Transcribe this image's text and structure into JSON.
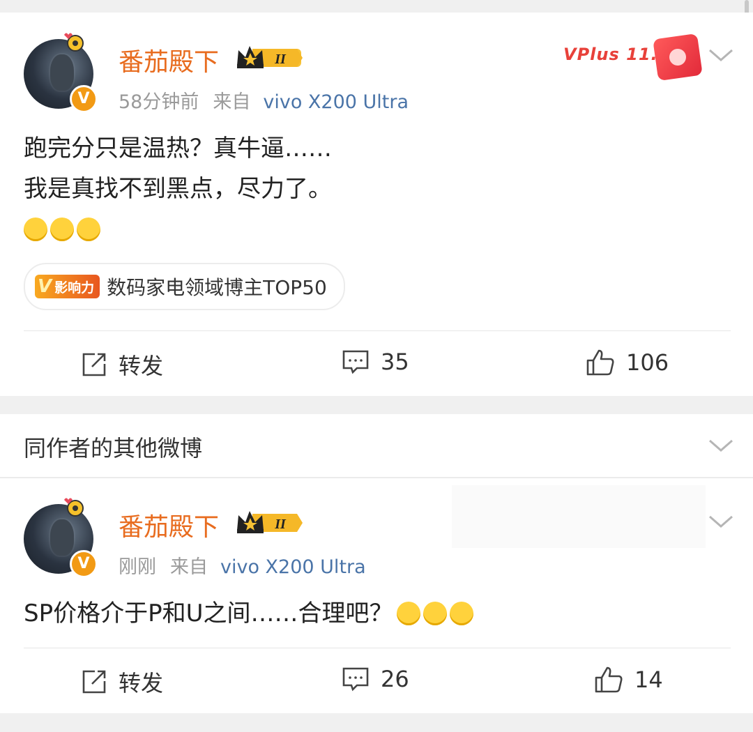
{
  "post1": {
    "username": "番茄殿下",
    "level_badge": "II",
    "time": "58分钟前",
    "from_label": "来自",
    "device": "vivo X200 Ultra",
    "content_lines": [
      "跑完分只是温热？真牛逼……",
      "我是真找不到黑点，尽力了。"
    ],
    "influence_badge_v": "V",
    "influence_badge_text": "影响力",
    "influence_label": "数码家电领域博主TOP50",
    "promo_text": "VPlus 11.11",
    "actions": {
      "repost": "转发",
      "comments": "35",
      "likes": "106"
    }
  },
  "section": {
    "title": "同作者的其他微博"
  },
  "post2": {
    "username": "番茄殿下",
    "level_badge": "II",
    "time": "刚刚",
    "from_label": "来自",
    "device": "vivo X200 Ultra",
    "content": "SP价格介于P和U之间……合理吧？",
    "actions": {
      "repost": "转发",
      "comments": "26",
      "likes": "14"
    }
  },
  "colors": {
    "username": "#e86c1f",
    "device_link": "#4a74a8",
    "meta": "#9a9a9a",
    "verified": "#f29a14"
  },
  "icons": [
    "verified-v-icon",
    "crown-level-icon",
    "chevron-down-icon",
    "repost-icon",
    "comment-icon",
    "like-icon",
    "emoji-icon"
  ]
}
